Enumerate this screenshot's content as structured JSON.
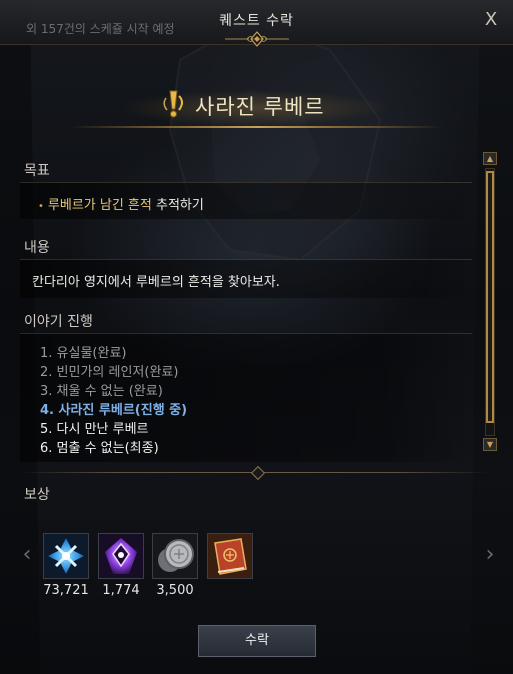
{
  "window": {
    "title": "퀘스트 수락",
    "close_label": "X",
    "behind_text": "외 157건의 스케쥴 시작 예정"
  },
  "quest": {
    "name": "사라진 루베르"
  },
  "objective": {
    "heading": "목표",
    "highlight": "루베르가 남긴 흔적",
    "rest": " 추적하기"
  },
  "content": {
    "heading": "내용",
    "text": "칸다리아 영지에서 루베르의 흔적을 찾아보자."
  },
  "story": {
    "heading": "이야기 진행",
    "items": [
      {
        "label": "1. 유실물(완료)",
        "state": "done"
      },
      {
        "label": "2. 빈민가의 레인저(완료)",
        "state": "done"
      },
      {
        "label": "3. 채울 수 없는 (완료)",
        "state": "done"
      },
      {
        "label": "4. 사라진 루베르(진행 중)",
        "state": "active"
      },
      {
        "label": "5. 다시 만난 루베르",
        "state": "todo"
      },
      {
        "label": "6. 멈출 수 없는(최종)",
        "state": "todo"
      }
    ]
  },
  "rewards": {
    "heading": "보상",
    "items": [
      {
        "icon": "blue-cross-crest-icon",
        "count": "73,721",
        "color": "#2f8fe0"
      },
      {
        "icon": "purple-emblem-icon",
        "count": "1,774",
        "color": "#8a3fe0"
      },
      {
        "icon": "silver-coin-icon",
        "count": "3,500",
        "color": "#b7b9bd"
      },
      {
        "icon": "red-book-icon",
        "count": "",
        "color": "#b8432a"
      }
    ],
    "prev_label": "‹",
    "next_label": "›"
  },
  "accept_button": {
    "label": "수락"
  },
  "colors": {
    "gold": "#c9a059",
    "active_story": "#7fb0e6",
    "objective_highlight": "#e8c77b"
  }
}
